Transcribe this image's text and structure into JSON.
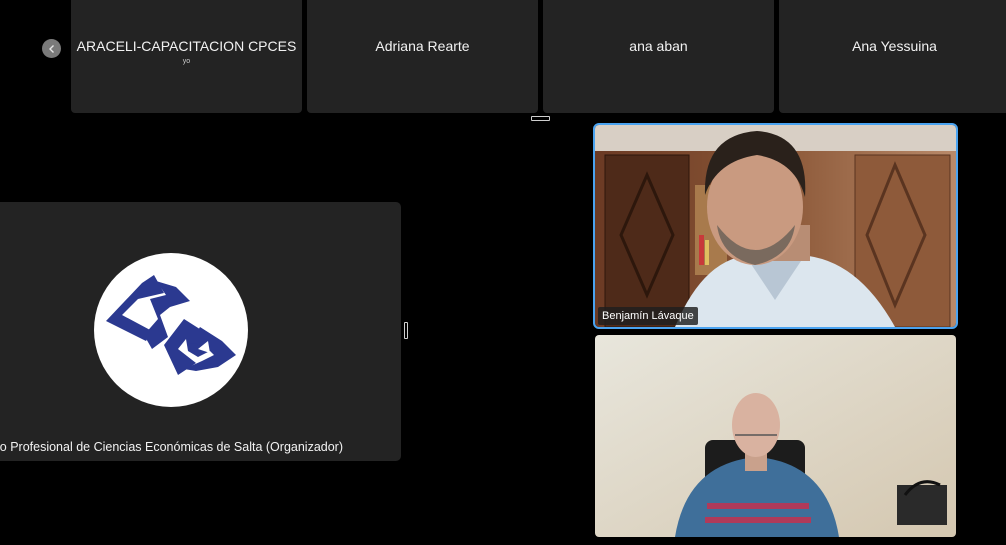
{
  "strip": {
    "prev_icon": "chevron-left-icon",
    "tiles": [
      {
        "name": "ARACELI-CAPACITACION CPCES",
        "sub": "yo"
      },
      {
        "name": "Adriana Rearte"
      },
      {
        "name": "ana aban"
      },
      {
        "name": "Ana Yessuina"
      }
    ]
  },
  "main": {
    "organizer_name": "jo Profesional de Ciencias Económicas de Salta (Organizador)",
    "logo_color": "#2b3990"
  },
  "videos": [
    {
      "name": "Benjamín Lávaque",
      "active": true
    },
    {
      "name": ""
    }
  ],
  "colors": {
    "active_border": "#4aa3f0",
    "tile_bg": "#232323"
  }
}
